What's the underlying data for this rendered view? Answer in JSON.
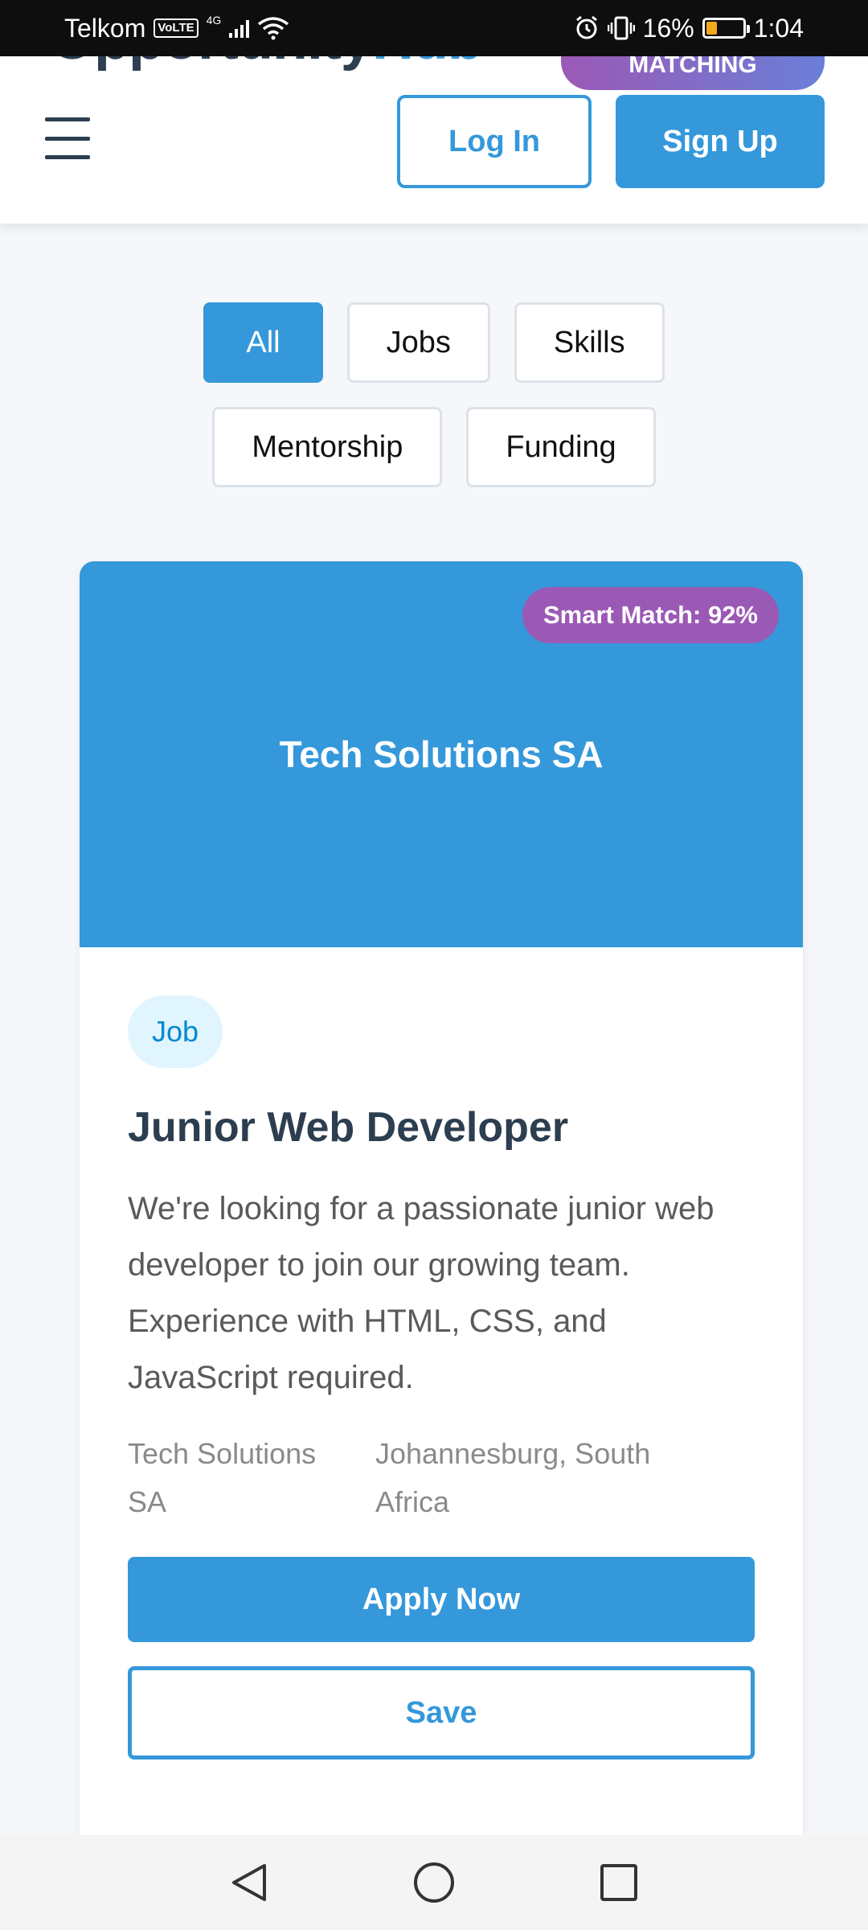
{
  "status_bar": {
    "carrier": "Telkom",
    "volte": "VoLTE",
    "network": "4G",
    "battery": "16%",
    "battery_level": 0.16,
    "time": "1:04"
  },
  "header": {
    "logo_text": "OpportunityHub",
    "logo_main": "Opportunity",
    "logo_accent": "Hub",
    "badge": "MATCHING",
    "login_label": "Log In",
    "signup_label": "Sign Up"
  },
  "filters": [
    {
      "label": "All",
      "active": true
    },
    {
      "label": "Jobs",
      "active": false
    },
    {
      "label": "Skills",
      "active": false
    },
    {
      "label": "Mentorship",
      "active": false
    },
    {
      "label": "Funding",
      "active": false
    }
  ],
  "card": {
    "hero_title": "Tech Solutions SA",
    "match_badge": "Smart Match: 92%",
    "type_tag": "Job",
    "title": "Junior Web Developer",
    "description": "We're looking for a passionate junior web developer to join our growing team. Experience with HTML, CSS, and JavaScript required.",
    "company": "Tech Solutions SA",
    "location": "Johannesburg, South Africa",
    "apply_label": "Apply Now",
    "save_label": "Save"
  },
  "colors": {
    "primary": "#3498db",
    "purple": "#9b59b6",
    "dark_text": "#2c3e50",
    "tag_bg": "#e1f5fe"
  },
  "icons": {
    "menu": "hamburger-icon",
    "back": "back-icon",
    "home": "home-icon",
    "recents": "recents-icon"
  }
}
